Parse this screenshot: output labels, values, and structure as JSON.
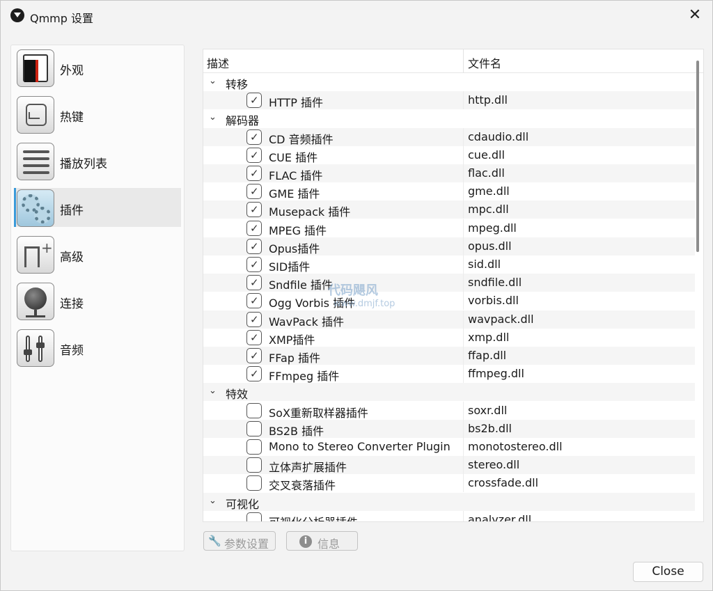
{
  "window": {
    "title": "Qmmp 设置",
    "close_icon": "close-icon"
  },
  "sidebar": {
    "items": [
      {
        "label": "外观",
        "icon": "appearance-icon"
      },
      {
        "label": "热键",
        "icon": "hotkey-icon"
      },
      {
        "label": "播放列表",
        "icon": "playlist-icon"
      },
      {
        "label": "插件",
        "icon": "plugins-icon",
        "active": true
      },
      {
        "label": "高级",
        "icon": "advanced-icon"
      },
      {
        "label": "连接",
        "icon": "network-icon"
      },
      {
        "label": "音频",
        "icon": "audio-icon"
      }
    ]
  },
  "plugins": {
    "header": {
      "description": "描述",
      "filename": "文件名"
    },
    "categories": [
      {
        "label": "转移",
        "items": [
          {
            "name": "HTTP 插件",
            "file": "http.dll",
            "checked": true
          }
        ]
      },
      {
        "label": "解码器",
        "items": [
          {
            "name": "CD 音频插件",
            "file": "cdaudio.dll",
            "checked": true
          },
          {
            "name": "CUE 插件",
            "file": "cue.dll",
            "checked": true
          },
          {
            "name": "FLAC 插件",
            "file": "flac.dll",
            "checked": true
          },
          {
            "name": "GME 插件",
            "file": "gme.dll",
            "checked": true
          },
          {
            "name": "Musepack 插件",
            "file": "mpc.dll",
            "checked": true
          },
          {
            "name": "MPEG 插件",
            "file": "mpeg.dll",
            "checked": true
          },
          {
            "name": "Opus插件",
            "file": "opus.dll",
            "checked": true
          },
          {
            "name": "SID插件",
            "file": "sid.dll",
            "checked": true
          },
          {
            "name": "Sndfile 插件",
            "file": "sndfile.dll",
            "checked": true
          },
          {
            "name": "Ogg Vorbis 插件",
            "file": "vorbis.dll",
            "checked": true
          },
          {
            "name": "WavPack 插件",
            "file": "wavpack.dll",
            "checked": true
          },
          {
            "name": "XMP插件",
            "file": "xmp.dll",
            "checked": true
          },
          {
            "name": "FFap   插件",
            "file": "ffap.dll",
            "checked": true
          },
          {
            "name": "FFmpeg 插件",
            "file": "ffmpeg.dll",
            "checked": true
          }
        ]
      },
      {
        "label": "特效",
        "items": [
          {
            "name": "SoX重新取样器插件",
            "file": "soxr.dll",
            "checked": false
          },
          {
            "name": "BS2B 插件",
            "file": "bs2b.dll",
            "checked": false
          },
          {
            "name": "Mono to Stereo Converter Plugin",
            "file": "monotostereo.dll",
            "checked": false
          },
          {
            "name": "立体声扩展插件",
            "file": "stereo.dll",
            "checked": false
          },
          {
            "name": "交叉衰落插件",
            "file": "crossfade.dll",
            "checked": false
          }
        ]
      },
      {
        "label": "可视化",
        "items": [
          {
            "name": "可视化分析器插件",
            "file": "analyzer.dll",
            "checked": false
          }
        ]
      }
    ]
  },
  "buttons": {
    "settings": "参数设置",
    "info": "信息",
    "close": "Close"
  },
  "watermark": {
    "line1": "代码飓风",
    "line2": "www.dmjf.top"
  }
}
